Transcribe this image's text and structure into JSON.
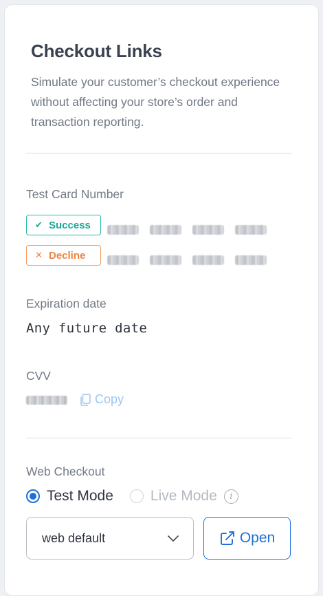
{
  "header": {
    "title": "Checkout Links",
    "description": "Simulate your customer’s checkout experience without affecting your store’s order and transaction reporting."
  },
  "test_card": {
    "label": "Test Card Number",
    "success_label": "Success",
    "decline_label": "Decline"
  },
  "expiration": {
    "label": "Expiration date",
    "value": "Any future date"
  },
  "cvv": {
    "label": "CVV",
    "copy_label": "Copy"
  },
  "web_checkout": {
    "label": "Web Checkout",
    "test_mode_label": "Test Mode",
    "live_mode_label": "Live Mode",
    "selected_mode": "Test Mode",
    "select_value": "web default",
    "open_label": "Open"
  },
  "colors": {
    "accent": "#1e6fd9",
    "success": "#1aa998",
    "decline": "#ee8540"
  }
}
